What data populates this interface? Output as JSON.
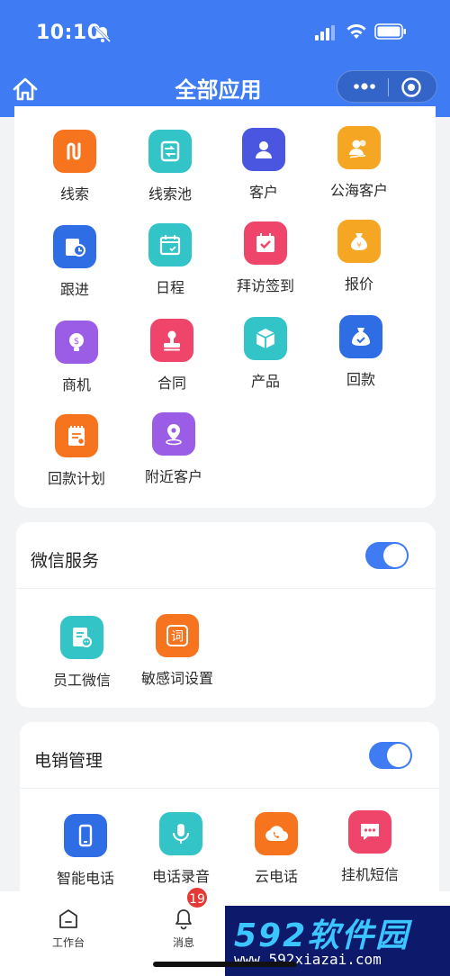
{
  "status": {
    "time": "10:10"
  },
  "header": {
    "title": "全部应用"
  },
  "apps": {
    "row1": [
      {
        "label": "线索",
        "color": "#f7741f",
        "icon": "route-icon"
      },
      {
        "label": "线索池",
        "color": "#33c4c8",
        "icon": "pool-icon"
      },
      {
        "label": "客户",
        "color": "#4a55e0",
        "icon": "person-icon"
      },
      {
        "label": "公海客户",
        "color": "#f5a623",
        "icon": "group-icon"
      }
    ],
    "row2": [
      {
        "label": "跟进",
        "color": "#2f6de5",
        "icon": "follow-icon"
      },
      {
        "label": "日程",
        "color": "#33c4c8",
        "icon": "calendar-icon"
      },
      {
        "label": "拜访签到",
        "color": "#f0456a",
        "icon": "checkin-icon"
      },
      {
        "label": "报价",
        "color": "#f5a623",
        "icon": "money-bag-icon"
      }
    ],
    "row3": [
      {
        "label": "商机",
        "color": "#9b5de5",
        "icon": "bulb-icon"
      },
      {
        "label": "合同",
        "color": "#f0456a",
        "icon": "stamp-icon"
      },
      {
        "label": "产品",
        "color": "#33c4c8",
        "icon": "box-icon"
      },
      {
        "label": "回款",
        "color": "#2f6de5",
        "icon": "bag-icon"
      }
    ],
    "row4": [
      {
        "label": "回款计划",
        "color": "#f7741f",
        "icon": "notepad-icon"
      },
      {
        "label": "附近客户",
        "color": "#9b5de5",
        "icon": "location-icon"
      }
    ]
  },
  "wechat": {
    "title": "微信服务",
    "toggle_on": true,
    "items": [
      {
        "label": "员工微信",
        "color": "#33c4c8",
        "icon": "staff-wechat-icon"
      },
      {
        "label": "敏感词设置",
        "color": "#f7741f",
        "icon": "word-icon"
      }
    ]
  },
  "tele": {
    "title": "电销管理",
    "toggle_on": true,
    "items": [
      {
        "label": "智能电话",
        "color": "#2f6de5",
        "icon": "phone-icon"
      },
      {
        "label": "电话录音",
        "color": "#33c4c8",
        "icon": "mic-icon"
      },
      {
        "label": "云电话",
        "color": "#f7741f",
        "icon": "cloud-phone-icon"
      },
      {
        "label": "挂机短信",
        "color": "#f0456a",
        "icon": "sms-icon"
      }
    ]
  },
  "word_glyph": "词",
  "tabbar": {
    "workbench": "工作台",
    "messages": "消息",
    "badge": "19"
  },
  "watermark": {
    "logo": "592软件园",
    "url": "www.592xiazai.com"
  }
}
